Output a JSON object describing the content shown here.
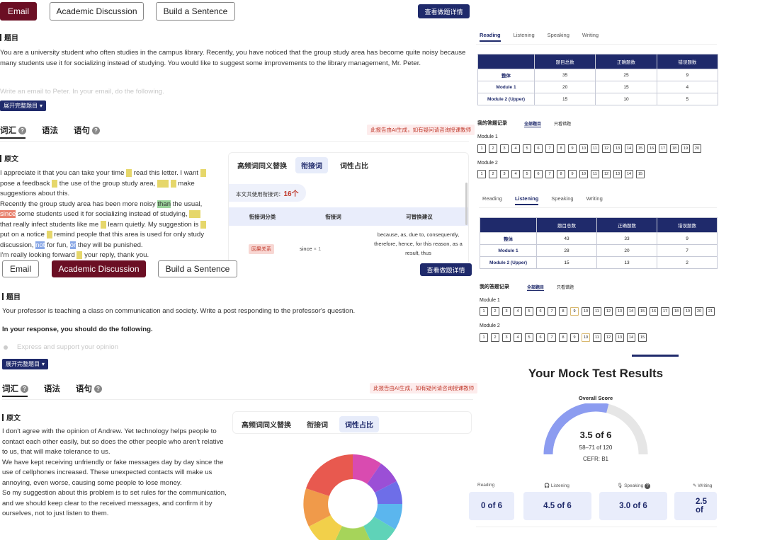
{
  "top": {
    "tabs": [
      "Email",
      "Academic Discussion",
      "Build a Sentence"
    ],
    "detail_button": "查看做题详情"
  },
  "email": {
    "section_title": "题目",
    "prompt": "You are a university student who often studies in the campus library. Recently, you have noticed that the group study area has become quite noisy because many students use it for socializing instead of studying. You would like to suggest some improvements to the library management, Mr. Peter.",
    "faded_line": "Write an email to Peter. In your email, do the following.",
    "expand_label": "展开完整题目",
    "subtabs": [
      "词汇",
      "语法",
      "语句"
    ],
    "disclaimer": "此报告由AI生成，如有疑问请咨询授课教师",
    "original_title": "原文",
    "essay": [
      [
        "I appreciate it that you can take your time ",
        "",
        "to",
        "y",
        " read this letter. I want ",
        "",
        "to",
        "y",
        ""
      ],
      [
        "pose a feedback ",
        "",
        "to",
        "y",
        " the use of the group study area, ",
        "",
        "and",
        "y",
        " ",
        "",
        "to",
        "y",
        " make"
      ],
      [
        "suggestions about this."
      ],
      [
        "Recently the group study area has been more noisy ",
        "",
        "than",
        "g",
        " the usual,"
      ],
      [
        "",
        "",
        "since",
        "r",
        " some students used it for socializing instead of studying, ",
        "",
        "and",
        "y"
      ],
      [
        "that really infect students like me ",
        "",
        "to",
        "y",
        " learn quietly. My suggestion is ",
        "",
        "to",
        "y"
      ],
      [
        "put on a notice ",
        "",
        "to",
        "y",
        " remind people that this area is used for only study"
      ],
      [
        "discussion, ",
        "",
        "not",
        "b",
        " for fun, ",
        "",
        "or",
        "b",
        " they will be punished."
      ],
      [
        "I'm really looking forward ",
        "",
        "to",
        "y",
        " your reply, thank you."
      ]
    ],
    "panel": {
      "tabs": [
        "高频词同义替换",
        "衔接词",
        "词性占比"
      ],
      "count_label": "本文共使用衔接词：",
      "count_value": "16个",
      "headers": [
        "衔接词分类",
        "衔接词",
        "可替换建议"
      ],
      "row": {
        "category": "因果关系",
        "word": "since",
        "times": "× 1",
        "suggestion": "because, as, due to, consequently, therefore, hence, for this reason, as a result, thus"
      }
    }
  },
  "discussion": {
    "section_title": "题目",
    "prompt": "Your professor is teaching a class on communication and society.  Write a post responding to the professor's question.",
    "instruction": "In your response, you should do the following.",
    "faded_line": "Express and support your opinion",
    "expand_label": "展开完整题目",
    "subtabs": [
      "词汇",
      "语法",
      "语句"
    ],
    "disclaimer": "此报告由AI生成，如有疑问请咨询授课教师",
    "original_title": "原文",
    "essay": "I don't agree with the opinion of Andrew. Yet technology helps people to contact each other easily, but so does the other people who aren't relative to us, that will make tolerance to us.\nWe have kept receiving unfriendly or fake messages day by day since the use of cellphones increased. These unexpected contacts will make us annoying, even worse, causing some people to lose money.\nSo my suggestion about this problem is to set rules for the communication, and we should keep clear to the received messages, and confirm it by ourselves, not to just listen to them.",
    "panel_tabs": [
      "高频词同义替换",
      "衔接词",
      "词性占比"
    ]
  },
  "reading": {
    "tabs": [
      "Reading",
      "Listening",
      "Speaking",
      "Writing"
    ],
    "headers": [
      "",
      "题目总数",
      "正确题数",
      "错误题数"
    ],
    "rows": [
      [
        "整体",
        "35",
        "25",
        "9"
      ],
      [
        "Module 1",
        "20",
        "15",
        "4"
      ],
      [
        "Module 2 (Upper)",
        "15",
        "10",
        "5"
      ]
    ],
    "records_title": "我的答题记录",
    "filter_all": "全部题目",
    "filter_wrong": "只看错题",
    "module1_label": "Module 1",
    "module2_label": "Module 2",
    "module1_count": 20,
    "module2_count": 15
  },
  "listening": {
    "tabs": [
      "Reading",
      "Listening",
      "Speaking",
      "Writing"
    ],
    "headers": [
      "",
      "题目总数",
      "正确题数",
      "错误题数"
    ],
    "rows": [
      [
        "整体",
        "43",
        "33",
        "9"
      ],
      [
        "Module 1",
        "28",
        "20",
        "7"
      ],
      [
        "Module 2 (Upper)",
        "15",
        "13",
        "2"
      ]
    ],
    "records_title": "我的答题记录",
    "filter_all": "全部题目",
    "filter_wrong": "只看错题",
    "module1_label": "Module 1",
    "module2_label": "Module 2",
    "module1_count": 21,
    "module2_count": 15
  },
  "results": {
    "title": "Your Mock Test Results",
    "overall_label": "Overall Score",
    "score": "3.5 of 6",
    "range": "58–71 of 120",
    "cefr": "CEFR: B1",
    "score_fraction": 0.58,
    "sections": [
      {
        "label": "Reading",
        "score": "0 of 6"
      },
      {
        "label": "Listening",
        "score": "4.5 of 6"
      },
      {
        "label": "Speaking",
        "score": "3.0 of 6"
      },
      {
        "label": "Writing",
        "score": "2.5 of"
      }
    ]
  },
  "colors": {
    "maroon": "#6b0f24",
    "navy": "#1f2a6b",
    "gauge_fill": "#8c9cf0",
    "gauge_track": "#e6e6e6"
  }
}
